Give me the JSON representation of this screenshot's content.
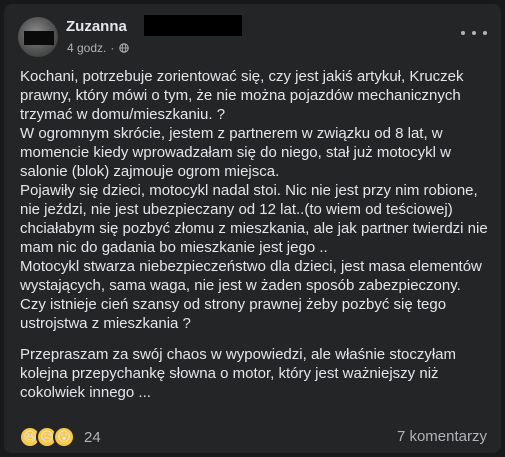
{
  "post": {
    "author": "Zuzanna",
    "time": "4 godz.",
    "separator": "·",
    "privacy_icon": "globe-icon",
    "more_icon": "more-dots-icon",
    "paragraphs": [
      "Kochani, potrzebuje zorientować się, czy jest jakiś artykuł, Kruczek prawny, który mówi o tym, że nie można pojazdów mechanicznych trzymać w domu/mieszkaniu. ?",
      "W ogromnym skrócie, jestem z partnerem w związku od 8 lat, w momencie kiedy wprowadzałam się do niego, stał już motocykl w salonie (blok) zajmouje ogrom miejsca.",
      "Pojawiły się dzieci, motocykl nadal stoi. Nic nie jest przy nim robione, nie jeździ, nie jest ubezpieczany od 12 lat..(to wiem od teściowej) chciałabym się pozbyć złomu z mieszkania, ale jak partner twierdzi nie mam nic do gadania bo mieszkanie jest jego ..",
      "Motocykl stwarza niebezpieczeństwo dla dzieci, jest masa elementów wystających, sama waga, nie jest w żaden sposób zabezpieczony.",
      "Czy istnieje cień szansy od strony prawnej żeby pozbyć się tego ustrojstwa z mieszkania ?",
      "Przepraszam za swój chaos w wypowiedzi, ale właśnie stoczyłam kolejna przepychankę słowna o motor, który jest ważniejszy niż cokolwiek innego ..."
    ]
  },
  "footer": {
    "reactions": [
      "😆",
      "😥",
      "😮"
    ],
    "reaction_count": "24",
    "comments": "7 komentarzy"
  },
  "colors": {
    "card": "#242526",
    "text": "#e4e6eb",
    "secondary": "#b0b3b8"
  }
}
